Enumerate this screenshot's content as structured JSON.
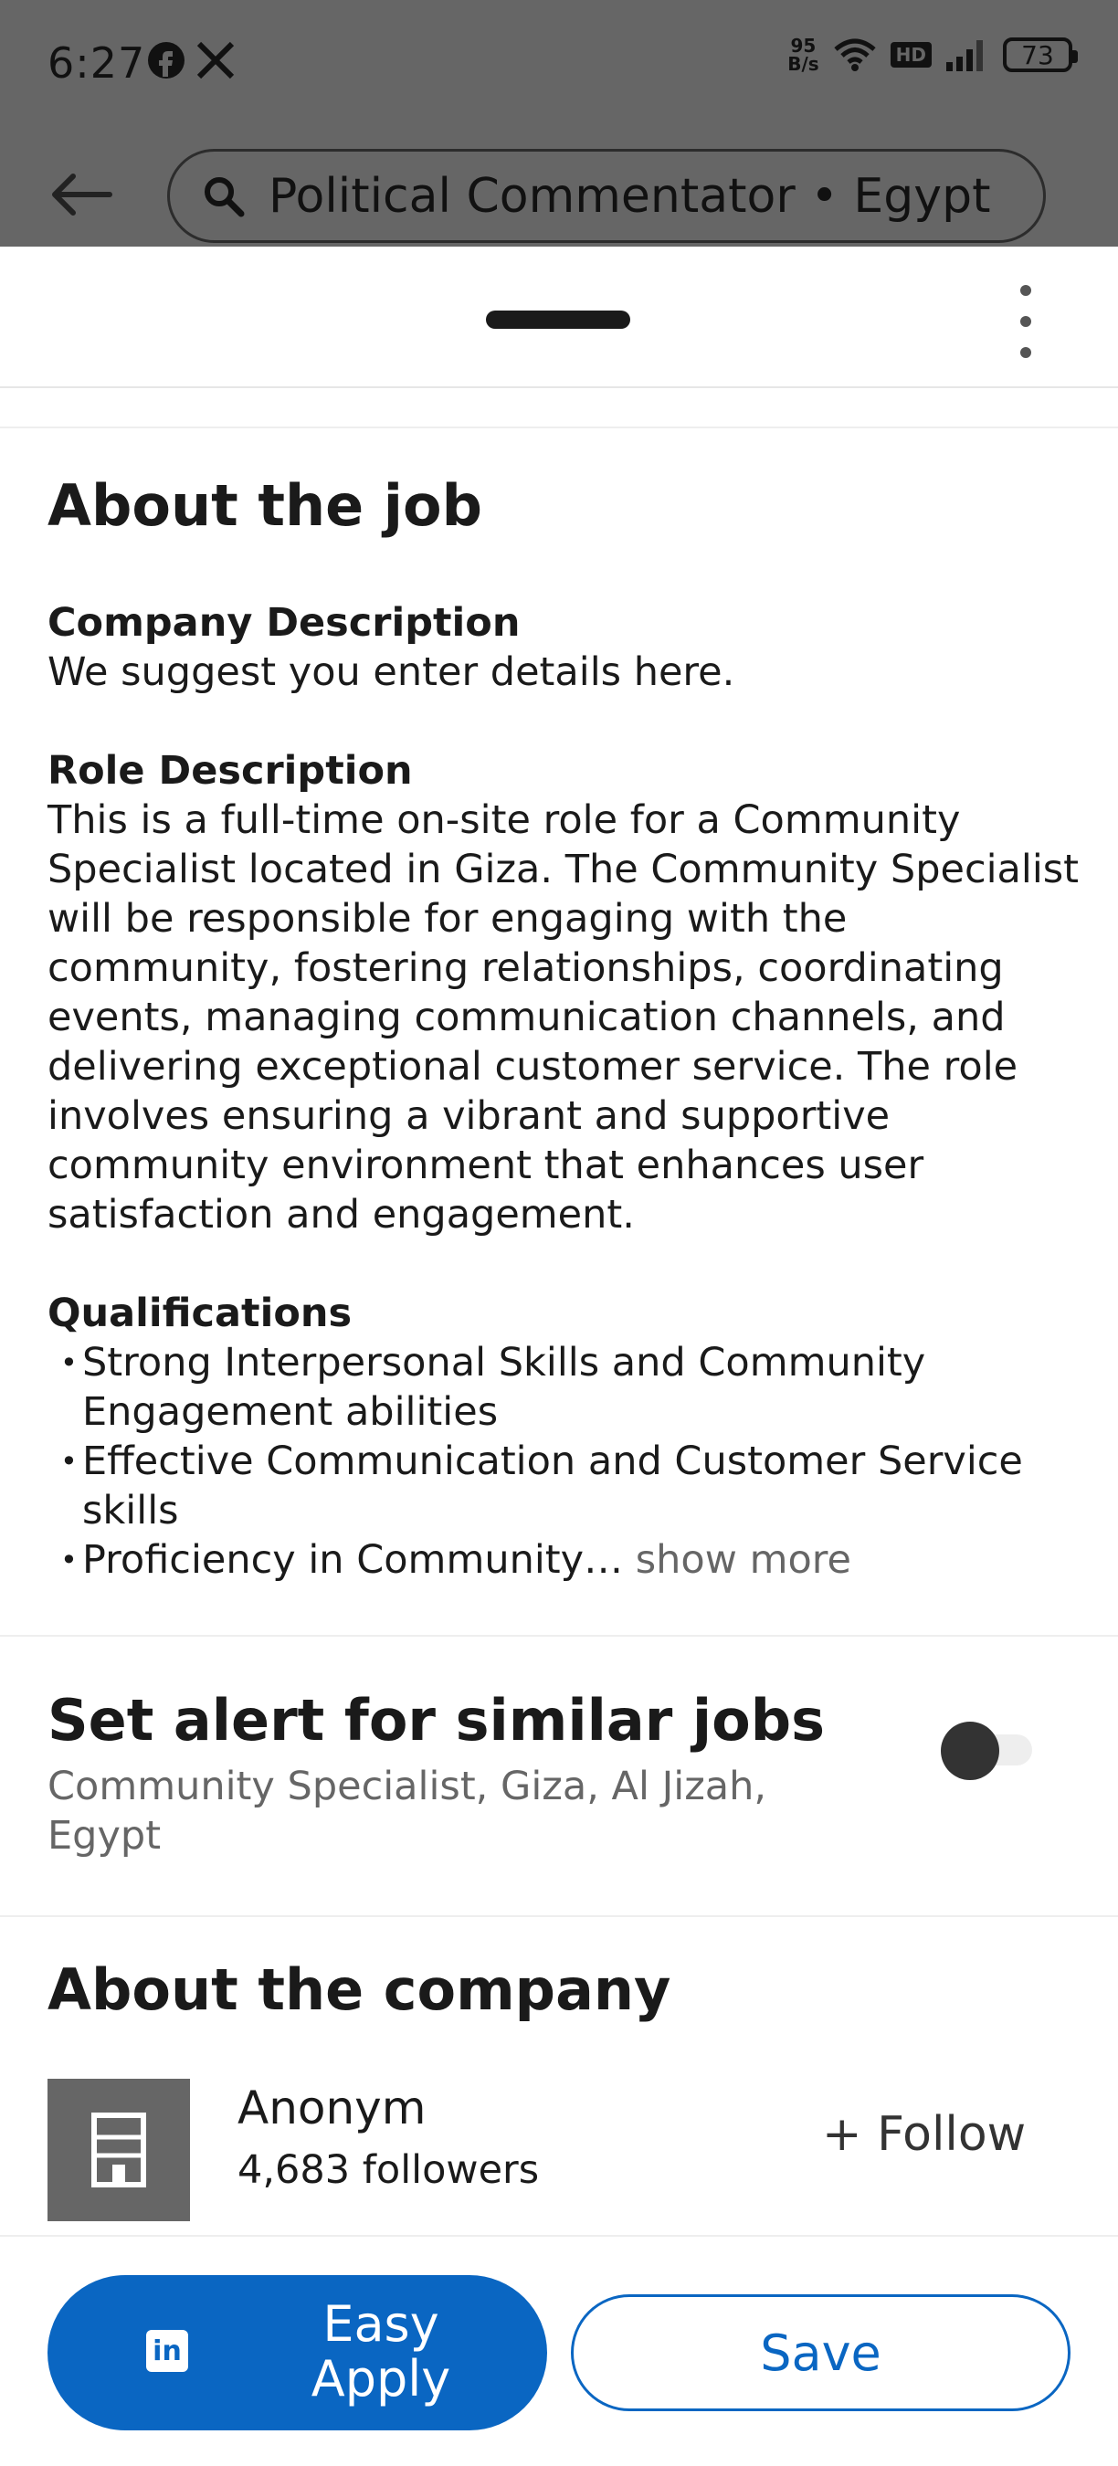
{
  "status_bar": {
    "time": "6:27",
    "net_speed_value": "95",
    "net_speed_unit": "B/s",
    "hd_label": "HD",
    "battery": "73"
  },
  "search": {
    "query": "Political Commentator • Egypt"
  },
  "job": {
    "about_title": "About the job",
    "company_desc_heading": "Company Description",
    "company_desc_text": "We suggest you enter details here.",
    "role_desc_heading": "Role Description",
    "role_desc_lines": [
      "This is a full-time on-site role for a Community",
      "Specialist located in Giza. The Community Specialist",
      "will be responsible for engaging with the",
      "community, fostering relationships, coordinating",
      "events, managing communication channels, and",
      "delivering exceptional customer service. The role",
      "involves ensuring a vibrant and supportive",
      "community environment that enhances user",
      "satisfaction and engagement."
    ],
    "qualifications_heading": "Qualifications",
    "qualifications": [
      [
        "Strong Interpersonal Skills and Community",
        "Engagement abilities"
      ],
      [
        "Effective Communication and Customer Service",
        "skills"
      ]
    ],
    "last_qualification": "Proficiency in Community…",
    "show_more": " show more"
  },
  "alert": {
    "title": "Set alert for similar jobs",
    "subtitle_line1": "Community Specialist, Giza, Al Jizah,",
    "subtitle_line2": "Egypt"
  },
  "company": {
    "section_title": "About the company",
    "name": "Anonym",
    "followers": "4,683 followers",
    "follow_label": "+ Follow"
  },
  "actions": {
    "apply_line1": "Easy",
    "apply_line2": "Apply",
    "save_label": "Save",
    "accent_color": "#0a66c2"
  }
}
